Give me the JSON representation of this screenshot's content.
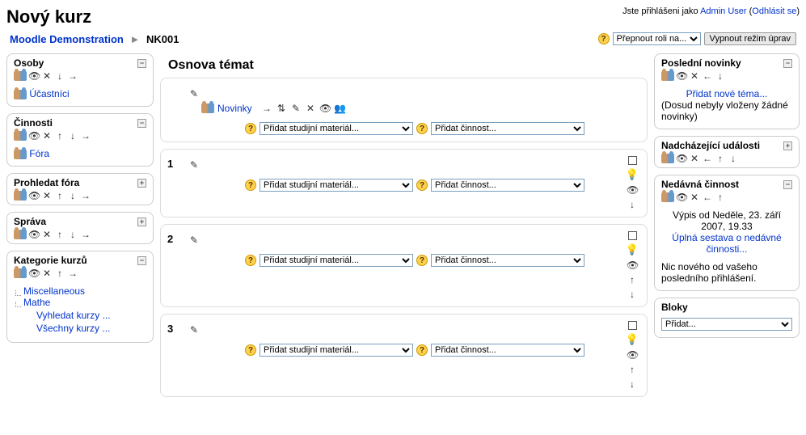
{
  "header": {
    "title": "Nový kurz",
    "login_prefix": "Jste přihlášeni jako ",
    "user": "Admin User",
    "logout": "Odhlásit se"
  },
  "breadcrumb": {
    "root": "Moodle Demonstration",
    "arrow": "►",
    "current": "NK001"
  },
  "navbar": {
    "role_select": "Přepnout roli na...",
    "edit_button": "Vypnout režim úprav"
  },
  "blocks_left": {
    "osoby": {
      "title": "Osoby",
      "link": "Účastníci"
    },
    "cinnosti": {
      "title": "Činnosti",
      "link": "Fóra"
    },
    "prohledat": {
      "title": "Prohledat fóra"
    },
    "sprava": {
      "title": "Správa"
    },
    "kategorie": {
      "title": "Kategorie kurzů",
      "cat1": "Miscellaneous",
      "cat2": "Mathe",
      "search": "Vyhledat kurzy ...",
      "all": "Všechny kurzy ..."
    }
  },
  "mid": {
    "heading": "Osnova témat",
    "novinky": "Novinky",
    "material_select": "Přidat studijní materiál...",
    "activity_select": "Přidat činnost...",
    "sec1": "1",
    "sec2": "2",
    "sec3": "3"
  },
  "blocks_right": {
    "novinky": {
      "title": "Poslední novinky",
      "add": "Přidat nové téma...",
      "empty": "(Dosud nebyly vloženy žádné novinky)"
    },
    "udalosti": {
      "title": "Nadcházející události"
    },
    "cinnost": {
      "title": "Nedávná činnost",
      "since": "Výpis od Neděle, 23. září 2007, 19.33",
      "report": "Úplná sestava o nedávné činnosti...",
      "nothing": "Nic nového od vašeho posledního přihlášení."
    },
    "bloky": {
      "title": "Bloky",
      "add": "Přidat..."
    }
  }
}
